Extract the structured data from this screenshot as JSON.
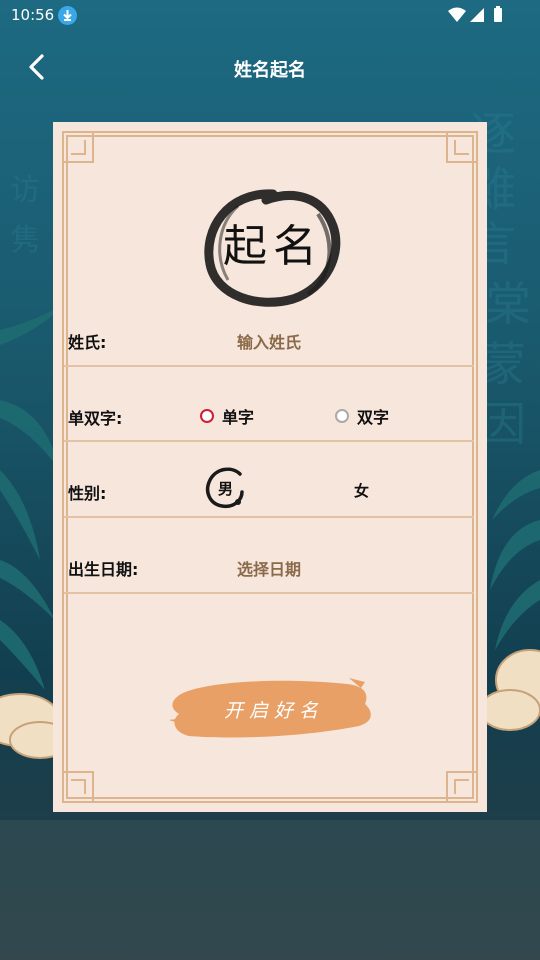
{
  "status_bar": {
    "time": "10:56",
    "icons": [
      "download-icon",
      "wifi-icon",
      "signal-icon",
      "battery-icon"
    ]
  },
  "header": {
    "title": "姓名起名",
    "back_icon": "chevron-left-icon"
  },
  "logo": {
    "text": "起名"
  },
  "form": {
    "surname": {
      "label": "姓氏:",
      "placeholder": "输入姓氏"
    },
    "char_count": {
      "label": "单双字:",
      "options": [
        "单字",
        "双字"
      ],
      "selected": "单字"
    },
    "gender": {
      "label": "性别:",
      "options": [
        "男",
        "女"
      ],
      "selected": "男"
    },
    "birth_date": {
      "label": "出生日期:",
      "placeholder": "选择日期"
    }
  },
  "cta": {
    "label": "开启好名"
  },
  "colors": {
    "accent_red": "#d11e2e",
    "card_bg": "#f7e6dc",
    "frame": "#e2c2a2",
    "brush": "#e9a066",
    "placeholder": "#8a6a4a"
  }
}
